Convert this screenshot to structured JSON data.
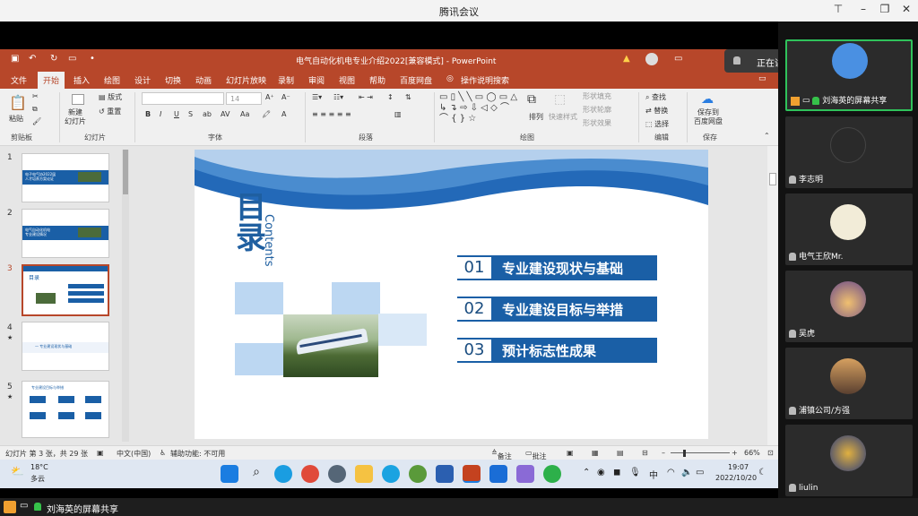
{
  "app": {
    "title": "腾讯会议",
    "speaking_label": "正在讲话: 刘海英;",
    "share_label": "刘海英的屏幕共享"
  },
  "ppt": {
    "title": "电气自动化机电专业介绍2022[兼容模式] - PowerPoint",
    "tabs": [
      "文件",
      "开始",
      "插入",
      "绘图",
      "设计",
      "切换",
      "动画",
      "幻灯片放映",
      "录制",
      "审阅",
      "视图",
      "帮助",
      "百度网盘"
    ],
    "tell_me": "操作说明搜索",
    "ribbon": {
      "paste": "粘贴",
      "new_slide": "新建\n幻灯片",
      "layout": "版式",
      "reset": "重置",
      "font_size": "14",
      "arrange": "排列",
      "quick_styles": "快速样式",
      "shape_fill": "形状填充",
      "shape_outline": "形状轮廓",
      "shape_effect": "形状效果",
      "find": "查找",
      "replace": "替换",
      "select": "选择",
      "save_baidu": "保存到\n百度网盘",
      "groups": {
        "clipboard": "剪贴板",
        "slides": "幻灯片",
        "font": "字体",
        "paragraph": "段落",
        "drawing": "绘图",
        "editing": "编辑",
        "save": "保存"
      }
    },
    "thumbs": [
      {
        "num": "1",
        "text": "电子电气协2022届\n人才培养方案论证"
      },
      {
        "num": "2",
        "text": "电气自动化机电\n专业建设情况"
      },
      {
        "num": "3",
        "text": "目录"
      },
      {
        "num": "4",
        "text": "一 专业建设现状与基础"
      },
      {
        "num": "5",
        "text": "专业建设目标与举措"
      }
    ],
    "slide": {
      "title_cn": "目录",
      "title_en": "Contents",
      "items": [
        {
          "num": "01",
          "text": "专业建设现状与基础"
        },
        {
          "num": "02",
          "text": "专业建设目标与举措"
        },
        {
          "num": "03",
          "text": "预计标志性成果"
        }
      ]
    },
    "status": {
      "slide_info": "幻灯片 第 3 张，共 29 张",
      "language": "中文(中国)",
      "accessibility": "辅助功能: 不可用",
      "notes": "备注",
      "comments": "批注",
      "zoom": "66%"
    }
  },
  "taskbar": {
    "weather_temp": "18°C",
    "weather_desc": "多云",
    "ime": "中",
    "time": "19:07",
    "date": "2022/10/20"
  },
  "participants": [
    {
      "name": "刘海英的屏幕共享",
      "avatar_color": "#4a90e2"
    },
    {
      "name": "李志明",
      "avatar_color": "#2a2a2a"
    },
    {
      "name": "电气王欣Mr.",
      "avatar_color": "#f2ecd8"
    },
    {
      "name": "吴虎",
      "avatar_color": "#d4a050"
    },
    {
      "name": "浦镇公司/方强",
      "avatar_color": "#b07040"
    },
    {
      "name": "liulin",
      "avatar_color": "#2a3b7a"
    }
  ],
  "colors": {
    "ppt_red": "#b7472a",
    "slide_blue": "#1a5fa6"
  }
}
